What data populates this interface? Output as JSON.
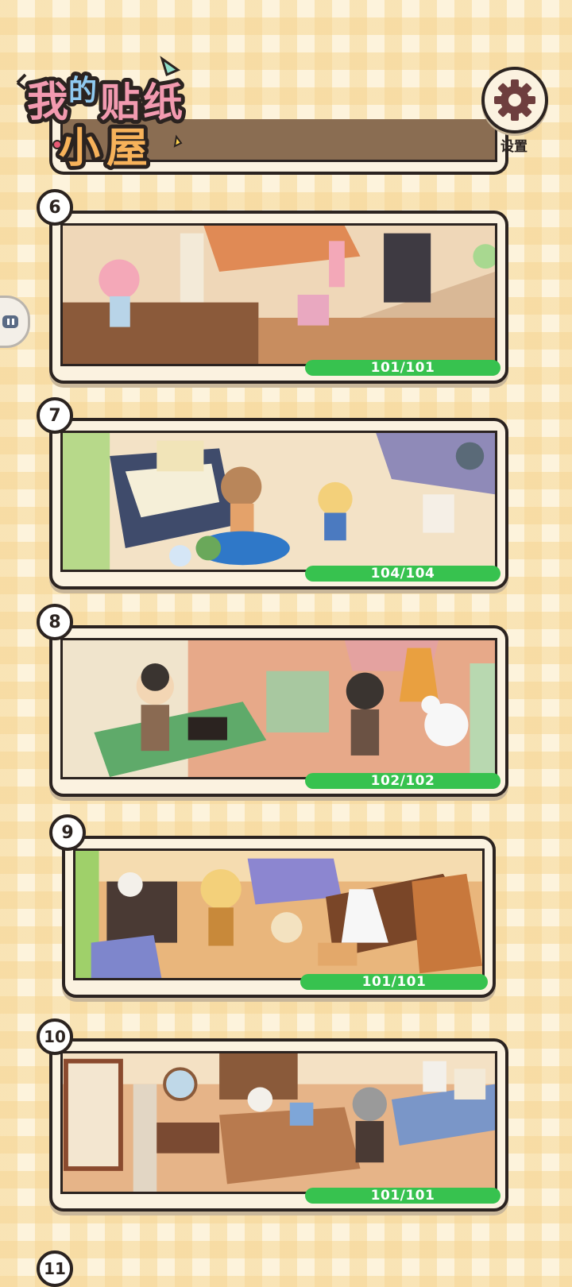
{
  "app": {
    "logo_text": "我的贴纸小屋"
  },
  "settings": {
    "label": "设置",
    "icon": "gear-icon"
  },
  "levels": [
    {
      "number": "6",
      "progress": "101/101",
      "fraction": 1.0
    },
    {
      "number": "7",
      "progress": "104/104",
      "fraction": 1.0
    },
    {
      "number": "8",
      "progress": "102/102",
      "fraction": 1.0
    },
    {
      "number": "9",
      "progress": "101/101",
      "fraction": 1.0
    },
    {
      "number": "10",
      "progress": "101/101",
      "fraction": 1.0
    },
    {
      "number": "11"
    }
  ],
  "colors": {
    "progress": "#37c24f",
    "outline": "#2b2320",
    "card": "#fbf2e0"
  }
}
